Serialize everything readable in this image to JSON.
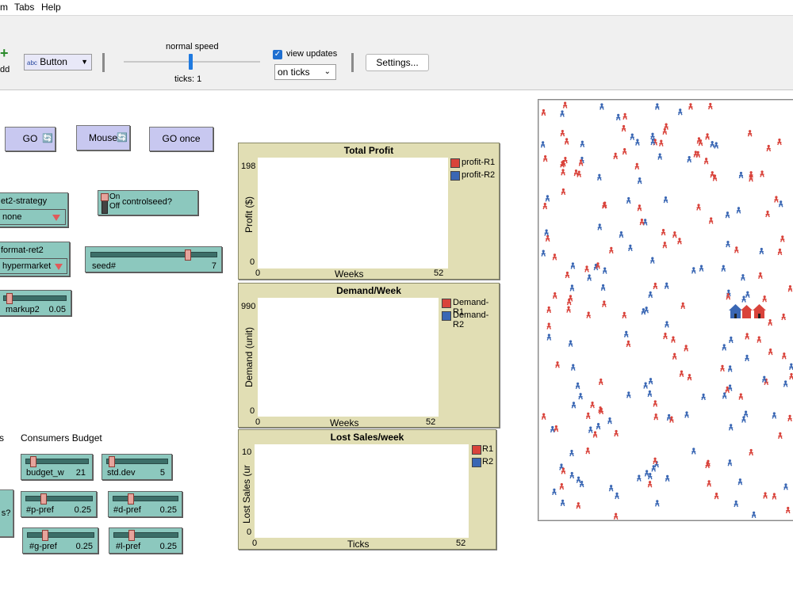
{
  "menu": {
    "items": [
      "m",
      "Tabs",
      "Help"
    ]
  },
  "toolbar": {
    "add_label": "dd",
    "widget_type": "Button",
    "abc_tag": "abc",
    "speed_label": "normal speed",
    "ticks_label": "ticks: 1",
    "view_updates_label": "view updates",
    "view_updates_checked": true,
    "update_mode": "on ticks",
    "settings_label": "Settings..."
  },
  "buttons": {
    "go": "GO",
    "mouse": "Mouse",
    "go_once": "GO once",
    "partial": "s?"
  },
  "choosers": {
    "ret2_strategy": {
      "label": "et2-strategy",
      "value": "none"
    },
    "format_ret2": {
      "label": "format-ret2",
      "value": "hypermarket"
    }
  },
  "switch": {
    "on": "On",
    "off": "Off",
    "label": "controlseed?"
  },
  "sliders": {
    "seed": {
      "label": "seed#",
      "value": "7",
      "fraction": 0.78
    },
    "markup2": {
      "label": "markup2",
      "value": "0.05",
      "fraction": 0.05
    },
    "budget_w": {
      "label": "budget_w",
      "value": "21",
      "fraction": 0.08
    },
    "std_dev": {
      "label": "std.dev",
      "value": "5",
      "fraction": 0.04
    },
    "p_pref": {
      "label": "#p-pref",
      "value": "0.25",
      "fraction": 0.25
    },
    "d_pref": {
      "label": "#d-pref",
      "value": "0.25",
      "fraction": 0.25
    },
    "g_pref": {
      "label": "#g-pref",
      "value": "0.25",
      "fraction": 0.25
    },
    "l_pref": {
      "label": "#l-pref",
      "value": "0.25",
      "fraction": 0.25
    }
  },
  "notes": {
    "s": "s",
    "consumers_budget": "Consumers Budget"
  },
  "colors": {
    "red": "#d9433b",
    "blue": "#3a67b4"
  },
  "chart_data": [
    {
      "type": "line",
      "title": "Total Profit",
      "xlabel": "Weeks",
      "ylabel": "Profit ($)",
      "xlim": [
        0,
        52
      ],
      "ylim": [
        0,
        198
      ],
      "x_tick_labels": [
        "0",
        "52"
      ],
      "y_tick_labels": [
        "0",
        "198"
      ],
      "legend_position": "right",
      "series": [
        {
          "name": "profit-R1",
          "color": "#d9433b",
          "values": []
        },
        {
          "name": "profit-R2",
          "color": "#3a67b4",
          "values": []
        }
      ]
    },
    {
      "type": "line",
      "title": "Demand/Week",
      "xlabel": "Weeks",
      "ylabel": "Demand (unit)",
      "xlim": [
        0,
        52
      ],
      "ylim": [
        0,
        990
      ],
      "x_tick_labels": [
        "0",
        "52"
      ],
      "y_tick_labels": [
        "0",
        "990"
      ],
      "legend_position": "right",
      "series": [
        {
          "name": "Demand-R1",
          "color": "#d9433b",
          "values": []
        },
        {
          "name": "Demand-R2",
          "color": "#3a67b4",
          "values": []
        }
      ]
    },
    {
      "type": "line",
      "title": "Lost Sales/week",
      "xlabel": "Ticks",
      "ylabel": "Lost Sales (ur",
      "xlim": [
        0,
        52
      ],
      "ylim": [
        0,
        10
      ],
      "x_tick_labels": [
        "0",
        "52"
      ],
      "y_tick_labels": [
        "0",
        "10"
      ],
      "legend_position": "right",
      "series": [
        {
          "name": "R1",
          "color": "#d9433b",
          "values": []
        },
        {
          "name": "R2",
          "color": "#3a67b4",
          "values": []
        }
      ]
    }
  ]
}
